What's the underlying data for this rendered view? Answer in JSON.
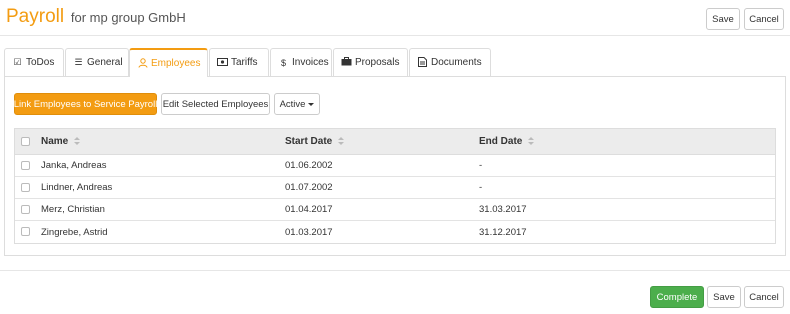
{
  "header": {
    "title_main": "Payroll",
    "title_sub": "for mp group GmbH",
    "save_label": "Save",
    "cancel_label": "Cancel"
  },
  "tabs": [
    {
      "label": "ToDos",
      "icon": "checkbox-icon",
      "active": false
    },
    {
      "label": "General",
      "icon": "list-icon",
      "active": false
    },
    {
      "label": "Employees",
      "icon": "user-icon",
      "active": true
    },
    {
      "label": "Tariffs",
      "icon": "money-icon",
      "active": false
    },
    {
      "label": "Invoices",
      "icon": "dollar-icon",
      "active": false
    },
    {
      "label": "Proposals",
      "icon": "briefcase-icon",
      "active": false
    },
    {
      "label": "Documents",
      "icon": "document-icon",
      "active": false
    }
  ],
  "toolbar": {
    "link_label": "Link Employees to Service Payroll",
    "edit_label": "Edit Selected Employees",
    "filter_label": "Active"
  },
  "table": {
    "columns": [
      "Name",
      "Start Date",
      "End Date"
    ],
    "rows": [
      {
        "name": "Janka, Andreas",
        "start": "01.06.2002",
        "end": "-"
      },
      {
        "name": "Lindner, Andreas",
        "start": "01.07.2002",
        "end": "-"
      },
      {
        "name": "Merz, Christian",
        "start": "01.04.2017",
        "end": "31.03.2017"
      },
      {
        "name": "Zingrebe, Astrid",
        "start": "01.03.2017",
        "end": "31.12.2017"
      }
    ]
  },
  "footer": {
    "complete_label": "Complete",
    "save_label": "Save",
    "cancel_label": "Cancel"
  },
  "colors": {
    "accent": "#f39c12",
    "success": "#4cae4c",
    "table_header_bg": "#ececec"
  }
}
